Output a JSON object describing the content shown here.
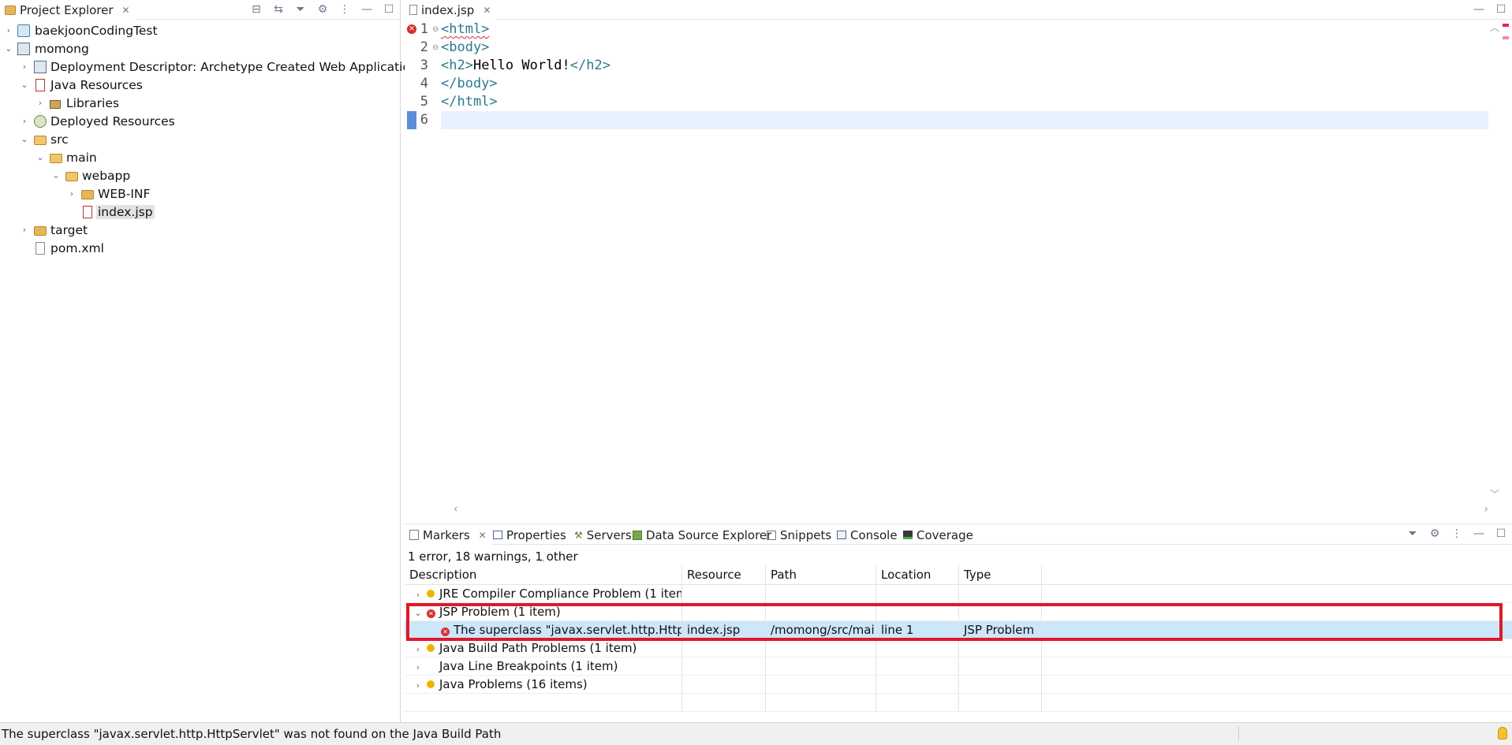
{
  "explorer": {
    "tab_label": "Project Explorer",
    "tree": [
      {
        "label": "baekjoonCodingTest",
        "icon": "project-icon"
      },
      {
        "label": "momong",
        "icon": "maven-project-icon"
      },
      {
        "label": "Deployment Descriptor: Archetype Created Web Application",
        "icon": "deployment-descriptor-icon"
      },
      {
        "label": "Java Resources",
        "icon": "java-resources-icon"
      },
      {
        "label": "Libraries",
        "icon": "libraries-icon"
      },
      {
        "label": "Deployed Resources",
        "icon": "deployed-resources-icon"
      },
      {
        "label": "src",
        "icon": "folder-error-icon"
      },
      {
        "label": "main",
        "icon": "folder-error-icon"
      },
      {
        "label": "webapp",
        "icon": "folder-error-icon"
      },
      {
        "label": "WEB-INF",
        "icon": "folder-icon"
      },
      {
        "label": "index.jsp",
        "icon": "jsp-file-error-icon"
      },
      {
        "label": "target",
        "icon": "folder-icon"
      },
      {
        "label": "pom.xml",
        "icon": "xml-file-icon"
      }
    ]
  },
  "editor": {
    "tab_label": "index.jsp",
    "lines": [
      {
        "num": "1",
        "tag1": "<html>",
        "text": "",
        "tag2": ""
      },
      {
        "num": "2",
        "tag1": "<body>",
        "text": "",
        "tag2": ""
      },
      {
        "num": "3",
        "tag1": "<h2>",
        "text": "Hello World!",
        "tag2": "</h2>"
      },
      {
        "num": "4",
        "tag1": "</body>",
        "text": "",
        "tag2": ""
      },
      {
        "num": "5",
        "tag1": "</html>",
        "text": "",
        "tag2": ""
      },
      {
        "num": "6",
        "tag1": "",
        "text": "",
        "tag2": ""
      }
    ]
  },
  "markers": {
    "tabs": [
      "Markers",
      "Properties",
      "Servers",
      "Data Source Explorer",
      "Snippets",
      "Console",
      "Coverage"
    ],
    "summary": "1 error, 18 warnings, 1 other",
    "columns": [
      "Description",
      "Resource",
      "Path",
      "Location",
      "Type"
    ],
    "rows": [
      {
        "description": "JRE Compiler Compliance Problem (1 item)",
        "resource": "",
        "path": "",
        "location": "",
        "type": "",
        "severity": "warning"
      },
      {
        "description": "JSP Problem (1 item)",
        "resource": "",
        "path": "",
        "location": "",
        "type": "",
        "severity": "error"
      },
      {
        "description": "The superclass \"javax.servlet.http.HttpServl",
        "resource": "index.jsp",
        "path": "/momong/src/mai...",
        "location": "line 1",
        "type": "JSP Problem",
        "severity": "error"
      },
      {
        "description": "Java Build Path Problems (1 item)",
        "resource": "",
        "path": "",
        "location": "",
        "type": "",
        "severity": "warning"
      },
      {
        "description": "Java Line Breakpoints (1 item)",
        "resource": "",
        "path": "",
        "location": "",
        "type": "",
        "severity": "none"
      },
      {
        "description": "Java Problems (16 items)",
        "resource": "",
        "path": "",
        "location": "",
        "type": "",
        "severity": "warning"
      }
    ]
  },
  "status": {
    "message": "The superclass \"javax.servlet.http.HttpServlet\" was not found on the Java Build Path"
  },
  "colors": {
    "highlight_box": "#e01828",
    "selection": "#cce6fb",
    "current_line": "#e8f2fe"
  }
}
